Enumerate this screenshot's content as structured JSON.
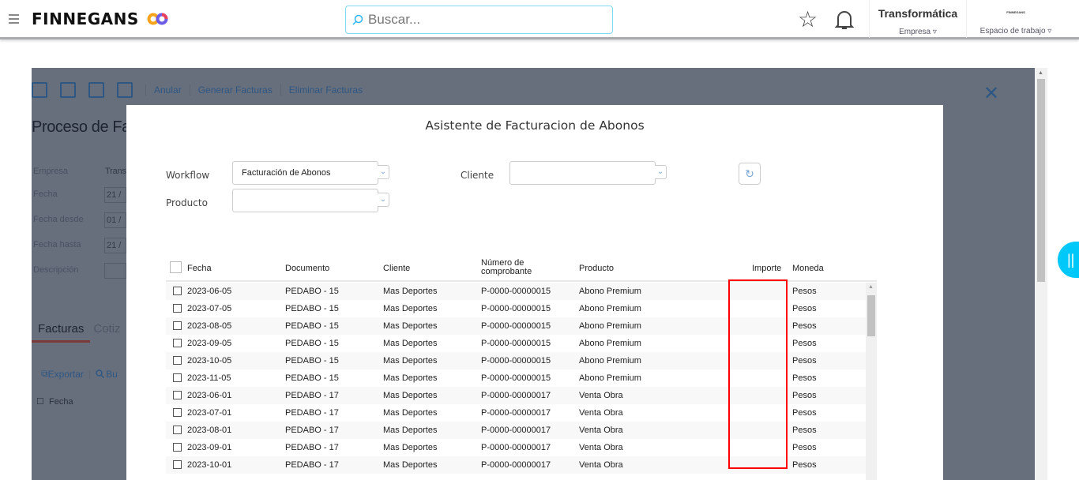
{
  "header": {
    "brand": "FINNEGANS",
    "search_placeholder": "Buscar...",
    "company": "Transformática",
    "company_label": "Empresa",
    "workspace_logo": "FINNEGANS",
    "workspace_label": "Espacio de trabajo"
  },
  "background": {
    "toolbar": [
      "Anular",
      "Generar Facturas",
      "Eliminar Facturas"
    ],
    "title": "Proceso de Fa",
    "fields": [
      {
        "label": "Empresa",
        "value": "Trans"
      },
      {
        "label": "Fecha",
        "value": "21 /"
      },
      {
        "label": "Fecha desde",
        "value": "01 /"
      },
      {
        "label": "Fecha hasta",
        "value": "21 /"
      },
      {
        "label": "Descripción",
        "value": ""
      }
    ],
    "tabs": [
      "Facturas",
      "Cotiz"
    ],
    "export": "Exportar",
    "search": "Bu",
    "col": "Fecha"
  },
  "modal": {
    "title": "Asistente de Facturacion de Abonos",
    "workflow_label": "Workflow",
    "workflow_value": "Facturación de Abonos",
    "cliente_label": "Cliente",
    "cliente_value": "",
    "producto_label": "Producto",
    "producto_value": "",
    "columns": [
      "Fecha",
      "Documento",
      "Cliente",
      "Número de comprobante",
      "Producto",
      "Importe",
      "Moneda"
    ],
    "rows": [
      [
        "2023-06-05",
        "PEDABO - 15",
        "Mas Deportes",
        "P-0000-00000015",
        "Abono Premium",
        "",
        "Pesos"
      ],
      [
        "2023-07-05",
        "PEDABO - 15",
        "Mas Deportes",
        "P-0000-00000015",
        "Abono Premium",
        "",
        "Pesos"
      ],
      [
        "2023-08-05",
        "PEDABO - 15",
        "Mas Deportes",
        "P-0000-00000015",
        "Abono Premium",
        "",
        "Pesos"
      ],
      [
        "2023-09-05",
        "PEDABO - 15",
        "Mas Deportes",
        "P-0000-00000015",
        "Abono Premium",
        "",
        "Pesos"
      ],
      [
        "2023-10-05",
        "PEDABO - 15",
        "Mas Deportes",
        "P-0000-00000015",
        "Abono Premium",
        "",
        "Pesos"
      ],
      [
        "2023-11-05",
        "PEDABO - 15",
        "Mas Deportes",
        "P-0000-00000015",
        "Abono Premium",
        "",
        "Pesos"
      ],
      [
        "2023-06-01",
        "PEDABO - 17",
        "Mas Deportes",
        "P-0000-00000017",
        "Venta Obra",
        "",
        "Pesos"
      ],
      [
        "2023-07-01",
        "PEDABO - 17",
        "Mas Deportes",
        "P-0000-00000017",
        "Venta Obra",
        "",
        "Pesos"
      ],
      [
        "2023-08-01",
        "PEDABO - 17",
        "Mas Deportes",
        "P-0000-00000017",
        "Venta Obra",
        "",
        "Pesos"
      ],
      [
        "2023-09-01",
        "PEDABO - 17",
        "Mas Deportes",
        "P-0000-00000017",
        "Venta Obra",
        "",
        "Pesos"
      ],
      [
        "2023-10-01",
        "PEDABO - 17",
        "Mas Deportes",
        "P-0000-00000017",
        "Venta Obra",
        "",
        "Pesos"
      ]
    ]
  },
  "colors": {
    "accent": "#00c8f8",
    "highlight": "#ff0000",
    "link": "#2a6eb0"
  }
}
